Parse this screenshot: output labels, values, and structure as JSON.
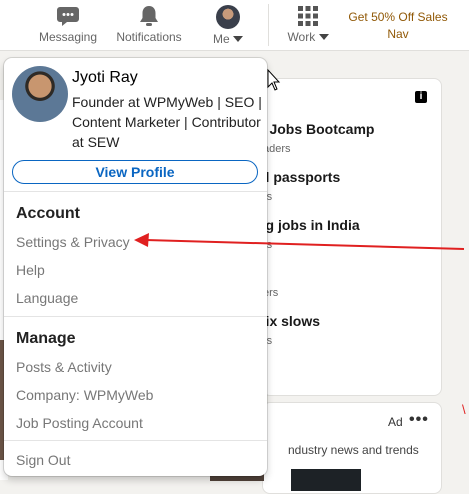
{
  "nav": {
    "messaging": "Messaging",
    "notifications": "Notifications",
    "me": "Me",
    "work": "Work",
    "promo_line1": "Get 50% Off Sales",
    "promo_line2": "Nav"
  },
  "profile": {
    "name": "Jyoti Ray",
    "headline": "Founder at WPMyWeb | SEO | Content Marketer | Contributor at SEW",
    "view_profile": "View Profile"
  },
  "account": {
    "title": "Account",
    "items": [
      "Settings & Privacy",
      "Help",
      "Language"
    ]
  },
  "manage": {
    "title": "Manage",
    "items": [
      "Posts & Activity",
      "Company: WPMyWeb",
      "Job Posting Account"
    ]
  },
  "sign_out": "Sign Out",
  "news": {
    "info": "i",
    "items": [
      {
        "title": "h Jobs Bootcamp",
        "sub": "aders"
      },
      {
        "title": "ul passports",
        "sub": "rs"
      },
      {
        "title": "ng jobs in India",
        "sub": "rs"
      },
      {
        "title": "e",
        "sub": "ers"
      },
      {
        "title": "flix slows",
        "sub": "rs"
      }
    ]
  },
  "ad": {
    "label": "Ad",
    "more": "•••",
    "text": "ndustry news and trends"
  },
  "colors": {
    "accent_blue": "#0a66c2",
    "promo_gold": "#915907",
    "annotation_red": "#e02020"
  },
  "icons": [
    "messaging-icon",
    "bell-icon",
    "avatar",
    "grid-icon",
    "chevron-down-icon",
    "info-icon",
    "cursor-icon",
    "red-arrow"
  ]
}
